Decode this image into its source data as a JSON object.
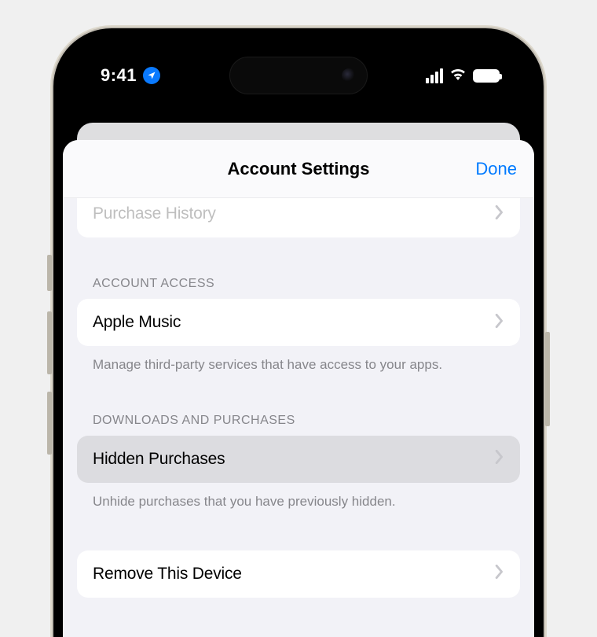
{
  "status": {
    "time": "9:41"
  },
  "modal": {
    "title": "Account Settings",
    "done": "Done"
  },
  "partial_row": {
    "label": "Purchase History"
  },
  "section1": {
    "header": "ACCOUNT ACCESS",
    "row": "Apple Music",
    "footer": "Manage third-party services that have access to your apps."
  },
  "section2": {
    "header": "DOWNLOADS AND PURCHASES",
    "row": "Hidden Purchases",
    "footer": "Unhide purchases that you have previously hidden."
  },
  "section3": {
    "row": "Remove This Device"
  }
}
